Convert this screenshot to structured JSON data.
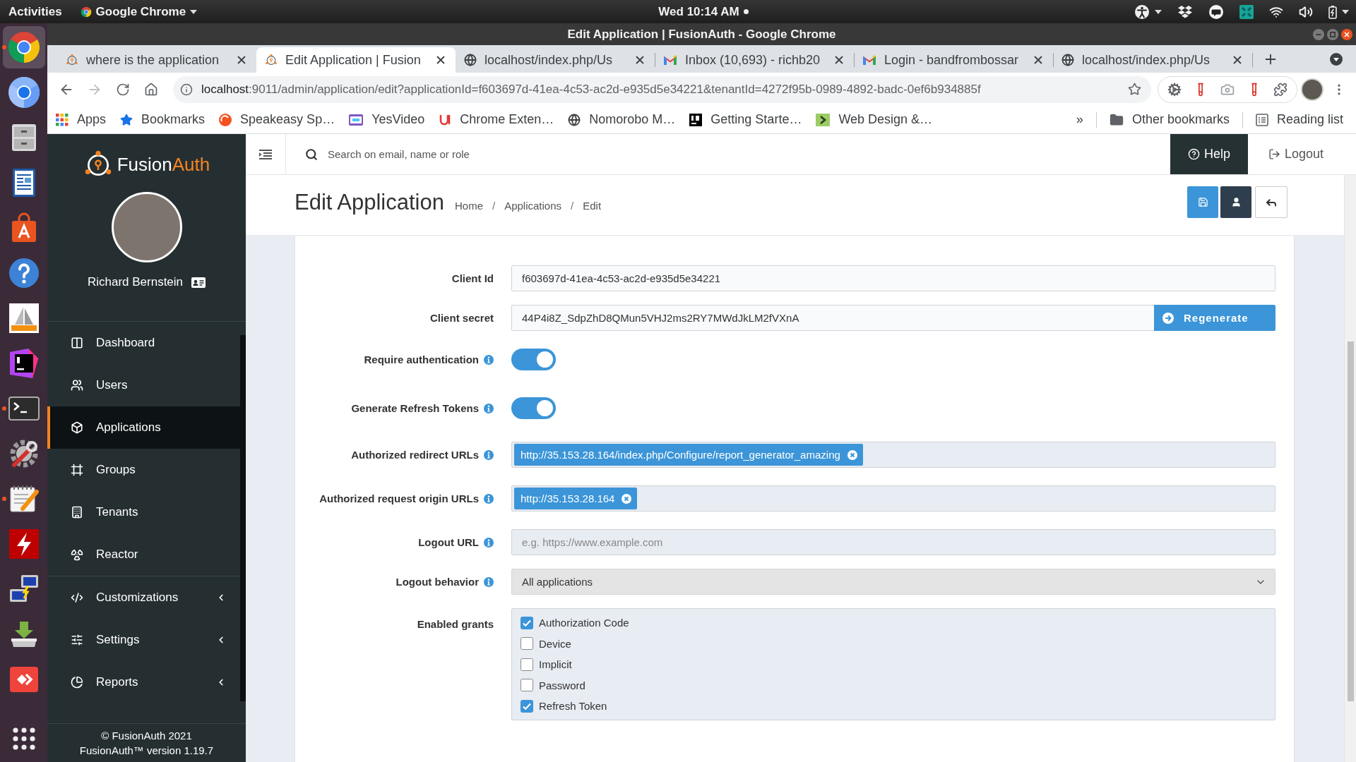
{
  "system_bar": {
    "activities": "Activities",
    "app_menu": "Google Chrome",
    "clock": "Wed 10:14 AM"
  },
  "dock": [
    {
      "kind": "chrome",
      "running": true,
      "selected": true
    },
    {
      "kind": "chromium",
      "running": false,
      "selected": false
    },
    {
      "kind": "files",
      "running": false,
      "selected": false
    },
    {
      "kind": "writer",
      "running": false,
      "selected": false
    },
    {
      "kind": "software",
      "running": false,
      "selected": false
    },
    {
      "kind": "help",
      "running": false,
      "selected": false
    },
    {
      "kind": "pma",
      "running": false,
      "selected": false
    },
    {
      "kind": "phpstorm",
      "running": false,
      "selected": false
    },
    {
      "kind": "terminal",
      "running": true,
      "selected": false
    },
    {
      "kind": "tools",
      "running": false,
      "selected": false
    },
    {
      "kind": "editor",
      "running": true,
      "selected": false
    },
    {
      "kind": "filezilla",
      "running": false,
      "selected": false
    },
    {
      "kind": "network",
      "running": false,
      "selected": false
    },
    {
      "kind": "installer",
      "running": false,
      "selected": false
    },
    {
      "kind": "anydesk",
      "running": false,
      "selected": false
    }
  ],
  "window": {
    "title": "Edit Application | FusionAuth - Google Chrome"
  },
  "tabs": [
    {
      "title": "where is the application",
      "kind": "fusionauth",
      "selected": false
    },
    {
      "title": "Edit Application | Fusion",
      "kind": "fusionauth",
      "selected": true
    },
    {
      "title": "localhost/index.php/Us",
      "kind": "globe",
      "selected": false
    },
    {
      "title": "Inbox (10,693) - richb20",
      "kind": "gmail",
      "selected": false
    },
    {
      "title": "Login - bandfrombossar",
      "kind": "gmail",
      "selected": false
    },
    {
      "title": "localhost/index.php/Us",
      "kind": "globe",
      "selected": false
    }
  ],
  "toolbar": {
    "back_disabled": false,
    "forward_disabled": true,
    "url_host": "localhost",
    "url_path": ":9011/admin/application/edit?applicationId=f603697d-41ea-4c53-ac2d-e935d5e34221&tenantId=4272f95b-0989-4892-badc-0ef6b934885f"
  },
  "bookmarks": [
    {
      "label": "Apps",
      "kind": "apps"
    },
    {
      "label": "Bookmarks",
      "kind": "star"
    },
    {
      "label": "Speakeasy Sp…",
      "kind": "speakeasy"
    },
    {
      "label": "YesVideo",
      "kind": "yesvideo"
    },
    {
      "label": "Chrome Exten…",
      "kind": "extensions"
    },
    {
      "label": "Nomorobo M…",
      "kind": "globe"
    },
    {
      "label": "Getting Starte…",
      "kind": "jetbrains"
    },
    {
      "label": "Web Design &…",
      "kind": "b3"
    }
  ],
  "bookmarks_overflow": "»",
  "other_bookmarks": "Other bookmarks",
  "reading_list": "Reading list",
  "sidebar": {
    "logo": {
      "part_1": "Fusion",
      "part_2": "Auth"
    },
    "user_name": "Richard Bernstein",
    "nav": [
      {
        "label": "Dashboard",
        "kind": "dashboard",
        "selected": false
      },
      {
        "label": "Users",
        "kind": "users",
        "selected": false
      },
      {
        "label": "Applications",
        "kind": "applications",
        "selected": true
      },
      {
        "label": "Groups",
        "kind": "groups",
        "selected": false
      },
      {
        "label": "Tenants",
        "kind": "tenants",
        "selected": false
      },
      {
        "label": "Reactor",
        "kind": "reactor",
        "selected": false
      }
    ],
    "nav_more": [
      {
        "label": "Customizations",
        "kind": "customizations",
        "expanded": false,
        "selected": false
      },
      {
        "label": "Settings",
        "kind": "settings",
        "expanded": false,
        "selected": false
      },
      {
        "label": "Reports",
        "kind": "reports",
        "expanded": false,
        "selected": false
      }
    ],
    "footer": [
      "© FusionAuth 2021",
      "FusionAuth™ version 1.19.7"
    ]
  },
  "header": {
    "search_placeholder": "Search on email, name or role",
    "help": "Help",
    "logout": "Logout"
  },
  "page": {
    "title": "Edit Application",
    "breadcrumbs": [
      {
        "kind": "link",
        "label": "Home"
      },
      {
        "kind": "separator",
        "label": "/"
      },
      {
        "kind": "link",
        "label": "Applications"
      },
      {
        "kind": "separator",
        "label": "/"
      },
      {
        "kind": "current",
        "label": "Edit"
      }
    ]
  },
  "form": {
    "fields": [
      {
        "kind": "text",
        "label": "Client Id",
        "value": "f603697d-41ea-4c53-ac2d-e935d5e34221",
        "readonly": true,
        "info": false
      },
      {
        "kind": "secret",
        "label": "Client secret",
        "value": "44P4i8Z_SdpZhD8QMun5VHJ2ms2RY7MWdJkLM2fVXnA",
        "readonly": true,
        "button": "Regenerate",
        "info": false
      },
      {
        "kind": "toggle",
        "label": "Require authentication",
        "on": true,
        "info": true
      },
      {
        "kind": "toggle",
        "label": "Generate Refresh Tokens",
        "on": true,
        "info": true
      },
      {
        "kind": "tags",
        "label": "Authorized redirect URLs",
        "tags": [
          "http://35.153.28.164/index.php/Configure/report_generator_amazing"
        ],
        "info": true
      },
      {
        "kind": "tags",
        "label": "Authorized request origin URLs",
        "tags": [
          "http://35.153.28.164"
        ],
        "info": true
      },
      {
        "kind": "text",
        "label": "Logout URL",
        "placeholder": "e.g. https://www.example.com",
        "readonly": false,
        "info": true
      },
      {
        "kind": "select",
        "label": "Logout behavior",
        "value": "All applications",
        "info": true
      },
      {
        "kind": "checkboxes",
        "label": "Enabled grants",
        "options": [
          {
            "label": "Authorization Code",
            "checked": true
          },
          {
            "label": "Device",
            "checked": false
          },
          {
            "label": "Implicit",
            "checked": false
          },
          {
            "label": "Password",
            "checked": false
          },
          {
            "label": "Refresh Token",
            "checked": true
          }
        ],
        "info": false
      }
    ]
  }
}
